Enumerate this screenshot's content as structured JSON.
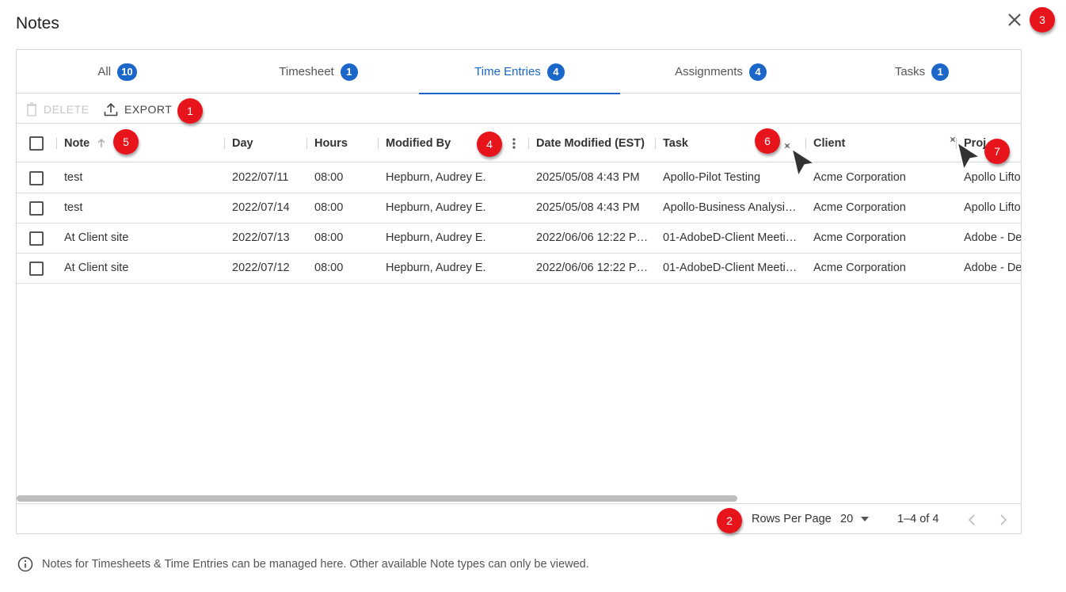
{
  "dialog": {
    "title": "Notes",
    "close_icon": "close-icon"
  },
  "tabs": [
    {
      "label": "All",
      "count": "10"
    },
    {
      "label": "Timesheet",
      "count": "1"
    },
    {
      "label": "Time Entries",
      "count": "4",
      "active": true
    },
    {
      "label": "Assignments",
      "count": "4"
    },
    {
      "label": "Tasks",
      "count": "1"
    }
  ],
  "toolbar": {
    "delete_label": "DELETE",
    "export_label": "EXPORT"
  },
  "columns": {
    "note": "Note",
    "day": "Day",
    "hours": "Hours",
    "modified_by": "Modified By",
    "date_modified": "Date Modified (EST)",
    "task": "Task",
    "client": "Client",
    "project": "Proj"
  },
  "rows": [
    {
      "note": "test",
      "day": "2022/07/11",
      "hours": "08:00",
      "modified_by": "Hepburn, Audrey E.",
      "date_modified": "2025/05/08 4:43 PM",
      "task": "Apollo-Pilot Testing",
      "client": "Acme Corporation",
      "project": "Apollo Liftoff"
    },
    {
      "note": "test",
      "day": "2022/07/14",
      "hours": "08:00",
      "modified_by": "Hepburn, Audrey E.",
      "date_modified": "2025/05/08 4:43 PM",
      "task": "Apollo-Business Analysis…",
      "client": "Acme Corporation",
      "project": "Apollo Liftoff"
    },
    {
      "note": "At Client site",
      "day": "2022/07/13",
      "hours": "08:00",
      "modified_by": "Hepburn, Audrey E.",
      "date_modified": "2022/06/06 12:22 P…",
      "task": "01-AdobeD-Client Meeti…",
      "client": "Acme Corporation",
      "project": "Adobe - Dev"
    },
    {
      "note": "At Client site",
      "day": "2022/07/12",
      "hours": "08:00",
      "modified_by": "Hepburn, Audrey E.",
      "date_modified": "2022/06/06 12:22 P…",
      "task": "01-AdobeD-Client Meeti…",
      "client": "Acme Corporation",
      "project": "Adobe - Dev"
    }
  ],
  "pagination": {
    "rows_per_page_label": "Rows Per Page",
    "rows_per_page_value": "20",
    "range": "1–4 of 4"
  },
  "info_note": "Notes for Timesheets & Time Entries can be managed here. Other available Note types can only be viewed.",
  "markers": [
    "1",
    "2",
    "3",
    "4",
    "5",
    "6",
    "7"
  ],
  "colors": {
    "accent": "#1a66c9",
    "marker": "#e8141c"
  }
}
